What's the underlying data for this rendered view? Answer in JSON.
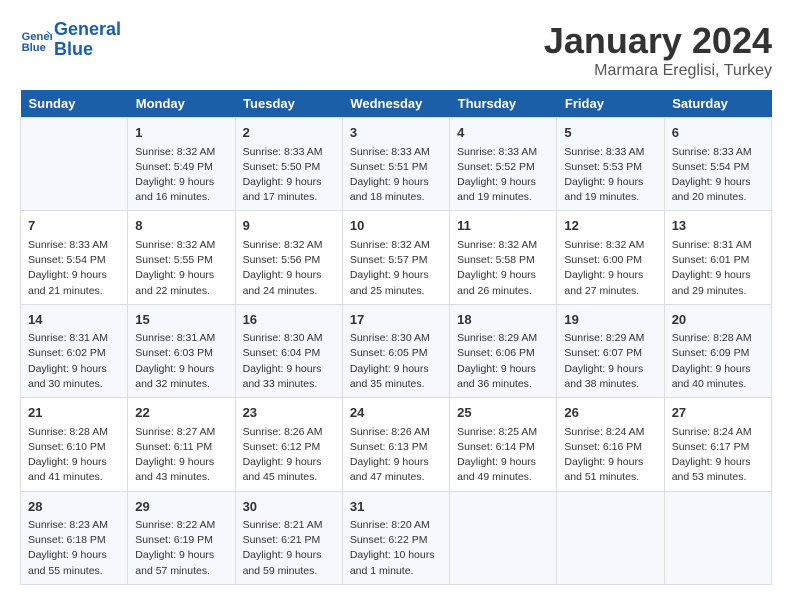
{
  "header": {
    "logo_line1": "General",
    "logo_line2": "Blue",
    "month": "January 2024",
    "location": "Marmara Ereglisi, Turkey"
  },
  "days_of_week": [
    "Sunday",
    "Monday",
    "Tuesday",
    "Wednesday",
    "Thursday",
    "Friday",
    "Saturday"
  ],
  "weeks": [
    [
      {
        "day": "",
        "content": ""
      },
      {
        "day": "1",
        "content": "Sunrise: 8:32 AM\nSunset: 5:49 PM\nDaylight: 9 hours\nand 16 minutes."
      },
      {
        "day": "2",
        "content": "Sunrise: 8:33 AM\nSunset: 5:50 PM\nDaylight: 9 hours\nand 17 minutes."
      },
      {
        "day": "3",
        "content": "Sunrise: 8:33 AM\nSunset: 5:51 PM\nDaylight: 9 hours\nand 18 minutes."
      },
      {
        "day": "4",
        "content": "Sunrise: 8:33 AM\nSunset: 5:52 PM\nDaylight: 9 hours\nand 19 minutes."
      },
      {
        "day": "5",
        "content": "Sunrise: 8:33 AM\nSunset: 5:53 PM\nDaylight: 9 hours\nand 19 minutes."
      },
      {
        "day": "6",
        "content": "Sunrise: 8:33 AM\nSunset: 5:54 PM\nDaylight: 9 hours\nand 20 minutes."
      }
    ],
    [
      {
        "day": "7",
        "content": "Sunrise: 8:33 AM\nSunset: 5:54 PM\nDaylight: 9 hours\nand 21 minutes."
      },
      {
        "day": "8",
        "content": "Sunrise: 8:32 AM\nSunset: 5:55 PM\nDaylight: 9 hours\nand 22 minutes."
      },
      {
        "day": "9",
        "content": "Sunrise: 8:32 AM\nSunset: 5:56 PM\nDaylight: 9 hours\nand 24 minutes."
      },
      {
        "day": "10",
        "content": "Sunrise: 8:32 AM\nSunset: 5:57 PM\nDaylight: 9 hours\nand 25 minutes."
      },
      {
        "day": "11",
        "content": "Sunrise: 8:32 AM\nSunset: 5:58 PM\nDaylight: 9 hours\nand 26 minutes."
      },
      {
        "day": "12",
        "content": "Sunrise: 8:32 AM\nSunset: 6:00 PM\nDaylight: 9 hours\nand 27 minutes."
      },
      {
        "day": "13",
        "content": "Sunrise: 8:31 AM\nSunset: 6:01 PM\nDaylight: 9 hours\nand 29 minutes."
      }
    ],
    [
      {
        "day": "14",
        "content": "Sunrise: 8:31 AM\nSunset: 6:02 PM\nDaylight: 9 hours\nand 30 minutes."
      },
      {
        "day": "15",
        "content": "Sunrise: 8:31 AM\nSunset: 6:03 PM\nDaylight: 9 hours\nand 32 minutes."
      },
      {
        "day": "16",
        "content": "Sunrise: 8:30 AM\nSunset: 6:04 PM\nDaylight: 9 hours\nand 33 minutes."
      },
      {
        "day": "17",
        "content": "Sunrise: 8:30 AM\nSunset: 6:05 PM\nDaylight: 9 hours\nand 35 minutes."
      },
      {
        "day": "18",
        "content": "Sunrise: 8:29 AM\nSunset: 6:06 PM\nDaylight: 9 hours\nand 36 minutes."
      },
      {
        "day": "19",
        "content": "Sunrise: 8:29 AM\nSunset: 6:07 PM\nDaylight: 9 hours\nand 38 minutes."
      },
      {
        "day": "20",
        "content": "Sunrise: 8:28 AM\nSunset: 6:09 PM\nDaylight: 9 hours\nand 40 minutes."
      }
    ],
    [
      {
        "day": "21",
        "content": "Sunrise: 8:28 AM\nSunset: 6:10 PM\nDaylight: 9 hours\nand 41 minutes."
      },
      {
        "day": "22",
        "content": "Sunrise: 8:27 AM\nSunset: 6:11 PM\nDaylight: 9 hours\nand 43 minutes."
      },
      {
        "day": "23",
        "content": "Sunrise: 8:26 AM\nSunset: 6:12 PM\nDaylight: 9 hours\nand 45 minutes."
      },
      {
        "day": "24",
        "content": "Sunrise: 8:26 AM\nSunset: 6:13 PM\nDaylight: 9 hours\nand 47 minutes."
      },
      {
        "day": "25",
        "content": "Sunrise: 8:25 AM\nSunset: 6:14 PM\nDaylight: 9 hours\nand 49 minutes."
      },
      {
        "day": "26",
        "content": "Sunrise: 8:24 AM\nSunset: 6:16 PM\nDaylight: 9 hours\nand 51 minutes."
      },
      {
        "day": "27",
        "content": "Sunrise: 8:24 AM\nSunset: 6:17 PM\nDaylight: 9 hours\nand 53 minutes."
      }
    ],
    [
      {
        "day": "28",
        "content": "Sunrise: 8:23 AM\nSunset: 6:18 PM\nDaylight: 9 hours\nand 55 minutes."
      },
      {
        "day": "29",
        "content": "Sunrise: 8:22 AM\nSunset: 6:19 PM\nDaylight: 9 hours\nand 57 minutes."
      },
      {
        "day": "30",
        "content": "Sunrise: 8:21 AM\nSunset: 6:21 PM\nDaylight: 9 hours\nand 59 minutes."
      },
      {
        "day": "31",
        "content": "Sunrise: 8:20 AM\nSunset: 6:22 PM\nDaylight: 10 hours\nand 1 minute."
      },
      {
        "day": "",
        "content": ""
      },
      {
        "day": "",
        "content": ""
      },
      {
        "day": "",
        "content": ""
      }
    ]
  ]
}
